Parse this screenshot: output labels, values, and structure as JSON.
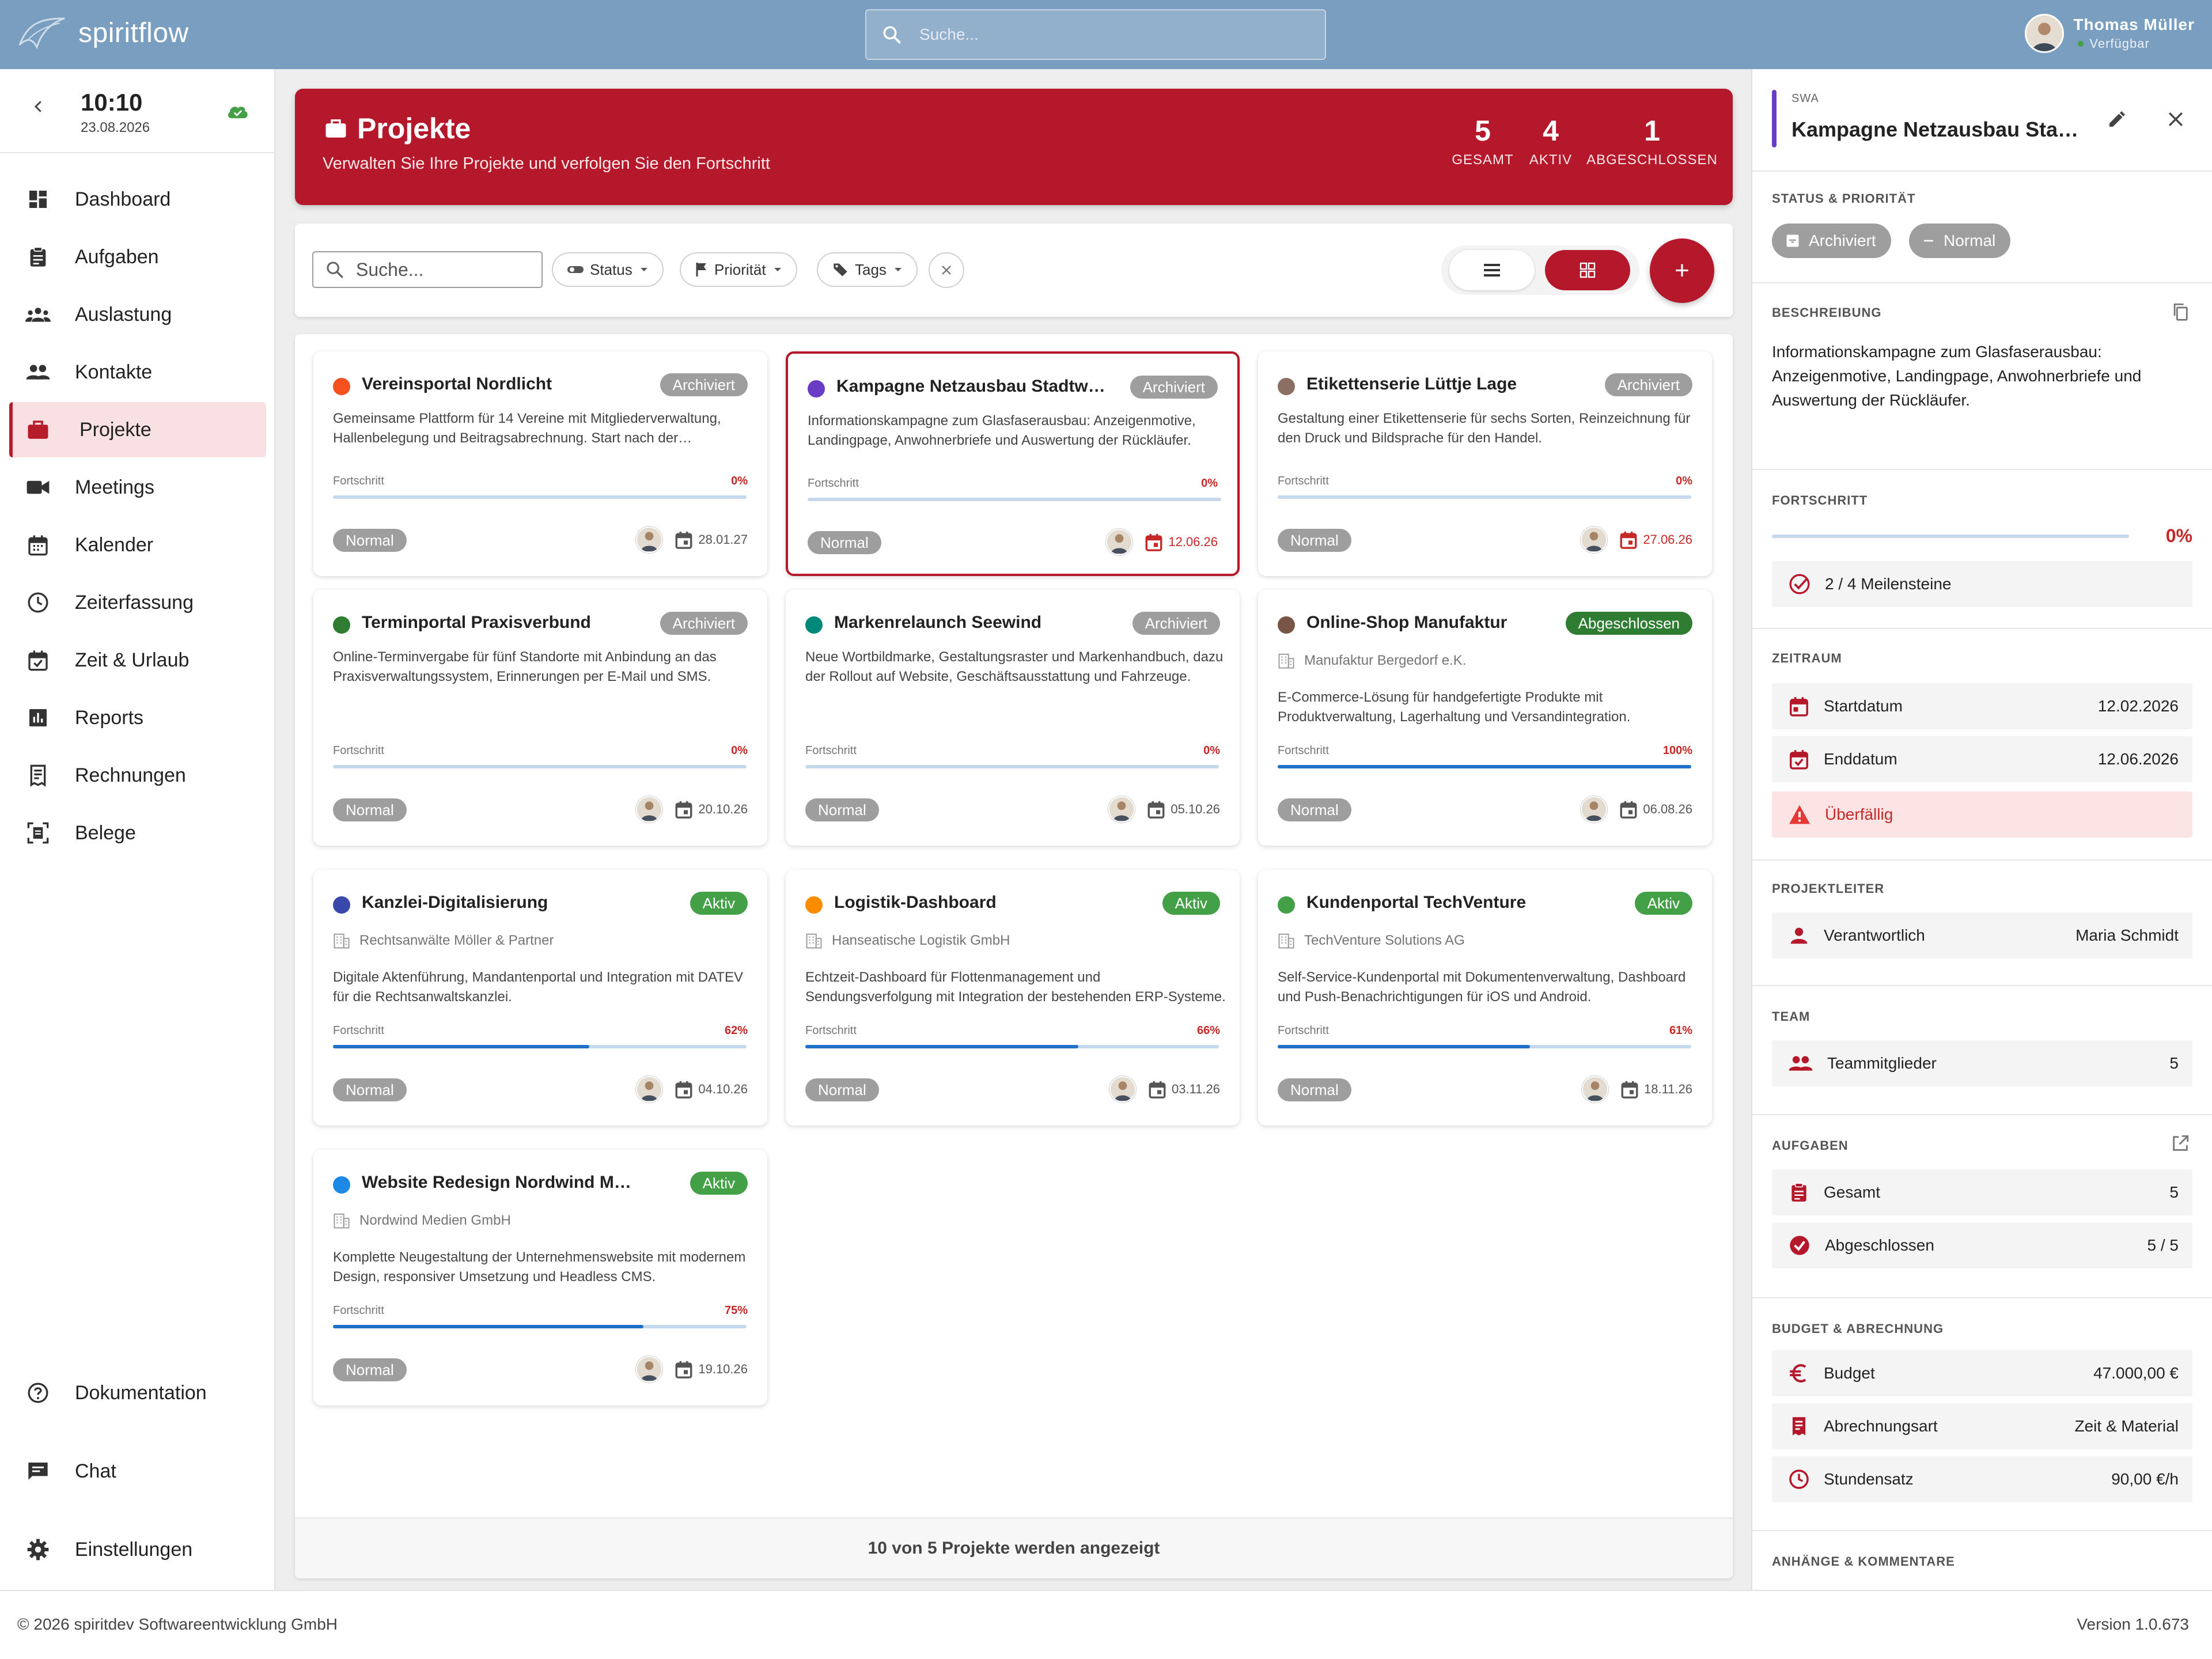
{
  "app": {
    "name": "spiritflow",
    "search_placeholder": "Suche...",
    "user": {
      "name": "Thomas Müller",
      "status": "Verfügbar"
    }
  },
  "clock": {
    "time": "10:10",
    "date": "23.08.2026"
  },
  "nav": {
    "items": [
      {
        "label": "Dashboard",
        "icon": "dashboard-icon"
      },
      {
        "label": "Aufgaben",
        "icon": "clipboard-icon"
      },
      {
        "label": "Auslastung",
        "icon": "groups-icon"
      },
      {
        "label": "Kontakte",
        "icon": "people-icon"
      },
      {
        "label": "Projekte",
        "icon": "briefcase-icon",
        "active": true
      },
      {
        "label": "Meetings",
        "icon": "video-icon"
      },
      {
        "label": "Kalender",
        "icon": "calendar-icon"
      },
      {
        "label": "Zeiterfassung",
        "icon": "clock-icon"
      },
      {
        "label": "Zeit & Urlaub",
        "icon": "calendar-check-icon"
      },
      {
        "label": "Reports",
        "icon": "bar-chart-icon"
      },
      {
        "label": "Rechnungen",
        "icon": "receipt-icon"
      },
      {
        "label": "Belege",
        "icon": "document-scan-icon"
      }
    ],
    "bottom": [
      {
        "label": "Dokumentation",
        "icon": "help-icon"
      },
      {
        "label": "Chat",
        "icon": "chat-icon"
      },
      {
        "label": "Einstellungen",
        "icon": "gear-icon"
      }
    ]
  },
  "header": {
    "title": "Projekte",
    "subtitle": "Verwalten Sie Ihre Projekte und verfolgen Sie den Fortschritt",
    "stats": [
      {
        "value": "5",
        "label": "GESAMT"
      },
      {
        "value": "4",
        "label": "AKTIV"
      },
      {
        "value": "1",
        "label": "ABGESCHLOSSEN"
      }
    ]
  },
  "filters": {
    "search_placeholder": "Suche...",
    "status": "Status",
    "priority": "Priorität",
    "tags": "Tags",
    "add_label": "+"
  },
  "colors": {
    "accent": "#b5182b",
    "archived": "#9e9e9e",
    "active": "#43a047",
    "done": "#2e7d32",
    "progress": "#1e70c8"
  },
  "projects": [
    {
      "title": "Vereinsportal Nordlicht",
      "status": "Archiviert",
      "dot": "#f4511e",
      "client": "",
      "desc": "Gemeinsame Plattform für 14 Vereine mit Mitgliederverwaltung, Hallenbelegung und Beitragsabrechnung. Start nach der Saisonpause.",
      "progress_label": "Fortschritt",
      "progress": "0%",
      "progress_value": 0,
      "priority": "Normal",
      "date": "28.01.27",
      "overdue": false
    },
    {
      "title": "Kampagne Netzausbau Stadtwerke Ahlen",
      "status": "Archiviert",
      "dot": "#6a3bc4",
      "client": "",
      "desc": "Informationskampagne zum Glasfaserausbau: Anzeigenmotive, Landingpage, Anwohnerbriefe und Auswertung der Rückläufer.",
      "progress_label": "Fortschritt",
      "progress": "0%",
      "progress_value": 0,
      "priority": "Normal",
      "date": "12.06.26",
      "overdue": true,
      "selected": true
    },
    {
      "title": "Etikettenserie Lüttje Lage",
      "status": "Archiviert",
      "dot": "#8d6e63",
      "client": "",
      "desc": "Gestaltung einer Etikettenserie für sechs Sorten, Reinzeichnung für den Druck und Bildsprache für den Handel.",
      "progress_label": "Fortschritt",
      "progress": "0%",
      "progress_value": 0,
      "priority": "Normal",
      "date": "27.06.26",
      "overdue": true
    },
    {
      "title": "Terminportal Praxisverbund",
      "status": "Archiviert",
      "dot": "#2e7d32",
      "client": "",
      "desc": "Online-Terminvergabe für fünf Standorte mit Anbindung an das Praxisverwaltungssystem, Erinnerungen per E-Mail und SMS.",
      "progress_label": "Fortschritt",
      "progress": "0%",
      "progress_value": 0,
      "priority": "Normal",
      "date": "20.10.26",
      "overdue": false
    },
    {
      "title": "Markenrelaunch Seewind",
      "status": "Archiviert",
      "dot": "#00897b",
      "client": "",
      "desc": "Neue Wortbildmarke, Gestaltungsraster und Markenhandbuch, dazu der Rollout auf Website, Geschäftsausstattung und Fahrzeuge.",
      "progress_label": "Fortschritt",
      "progress": "0%",
      "progress_value": 0,
      "priority": "Normal",
      "date": "05.10.26",
      "overdue": false
    },
    {
      "title": "Online-Shop Manufaktur",
      "status": "Abgeschlossen",
      "dot": "#795548",
      "client": "Manufaktur Bergedorf e.K.",
      "desc": "E-Commerce-Lösung für handgefertigte Produkte mit Produktverwaltung, Lagerhaltung und Versandintegration.",
      "progress_label": "Fortschritt",
      "progress": "100%",
      "progress_value": 100,
      "priority": "Normal",
      "date": "06.08.26",
      "overdue": false
    },
    {
      "title": "Kanzlei-Digitalisierung",
      "status": "Aktiv",
      "dot": "#3949ab",
      "client": "Rechtsanwälte Möller & Partner",
      "desc": "Digitale Aktenführung, Mandantenportal und Integration mit DATEV für die Rechtsanwaltskanzlei.",
      "progress_label": "Fortschritt",
      "progress": "62%",
      "progress_value": 62,
      "priority": "Normal",
      "date": "04.10.26",
      "overdue": false
    },
    {
      "title": "Logistik-Dashboard",
      "status": "Aktiv",
      "dot": "#fb8c00",
      "client": "Hanseatische Logistik GmbH",
      "desc": "Echtzeit-Dashboard für Flottenmanagement und Sendungsverfolgung mit Integration der bestehenden ERP-Systeme.",
      "progress_label": "Fortschritt",
      "progress": "66%",
      "progress_value": 66,
      "priority": "Normal",
      "date": "03.11.26",
      "overdue": false
    },
    {
      "title": "Kundenportal TechVenture",
      "status": "Aktiv",
      "dot": "#43a047",
      "client": "TechVenture Solutions AG",
      "desc": "Self-Service-Kundenportal mit Dokumentenverwaltung, Dashboard und Push-Benachrichtigungen für iOS und Android.",
      "progress_label": "Fortschritt",
      "progress": "61%",
      "progress_value": 61,
      "priority": "Normal",
      "date": "18.11.26",
      "overdue": false
    },
    {
      "title": "Website Redesign Nordwind Medien",
      "status": "Aktiv",
      "dot": "#1e88e5",
      "client": "Nordwind Medien GmbH",
      "desc": "Komplette Neugestaltung der Unternehmenswebsite mit modernem Design, responsiver Umsetzung und Headless CMS.",
      "progress_label": "Fortschritt",
      "progress": "75%",
      "progress_value": 75,
      "priority": "Normal",
      "date": "19.10.26",
      "overdue": false
    }
  ],
  "grid_footer": "10 von 5 Projekte werden angezeigt",
  "panel": {
    "code": "SWA",
    "title": "Kampagne Netzausbau Stadtwerke Ahlen",
    "status_title": "STATUS & PRIORITÄT",
    "status_chip": "Archiviert",
    "priority_chip": "Normal",
    "desc_title": "BESCHREIBUNG",
    "description": "Informationskampagne zum Glasfaserausbau: Anzeigenmotive, Landingpage, Anwohnerbriefe und Auswertung der Rückläufer.",
    "progress_title": "FORTSCHRITT",
    "progress": "0%",
    "progress_value": 0,
    "milestones": "2 / 4 Meilensteine",
    "period_title": "ZEITRAUM",
    "start_label": "Startdatum",
    "start": "12.02.2026",
    "end_label": "Enddatum",
    "end": "12.06.2026",
    "overdue": "Überfällig",
    "lead_title": "PROJEKTLEITER",
    "lead_label": "Verantwortlich",
    "lead": "Maria Schmidt",
    "team_title": "TEAM",
    "team_label": "Teammitglieder",
    "team": "5",
    "tasks_title": "AUFGABEN",
    "tasks_total_label": "Gesamt",
    "tasks_total": "5",
    "tasks_done_label": "Abgeschlossen",
    "tasks_done": "5 / 5",
    "budget_title": "BUDGET & ABRECHNUNG",
    "budget_label": "Budget",
    "budget": "47.000,00 €",
    "billing_label": "Abrechnungsart",
    "billing": "Zeit & Material",
    "rate_label": "Stundensatz",
    "rate": "90,00 €/h",
    "attach_title": "ANHÄNGE & KOMMENTARE"
  },
  "footer": {
    "copyright": "© 2026 spiritdev Softwareentwicklung GmbH",
    "version": "Version 1.0.673"
  }
}
